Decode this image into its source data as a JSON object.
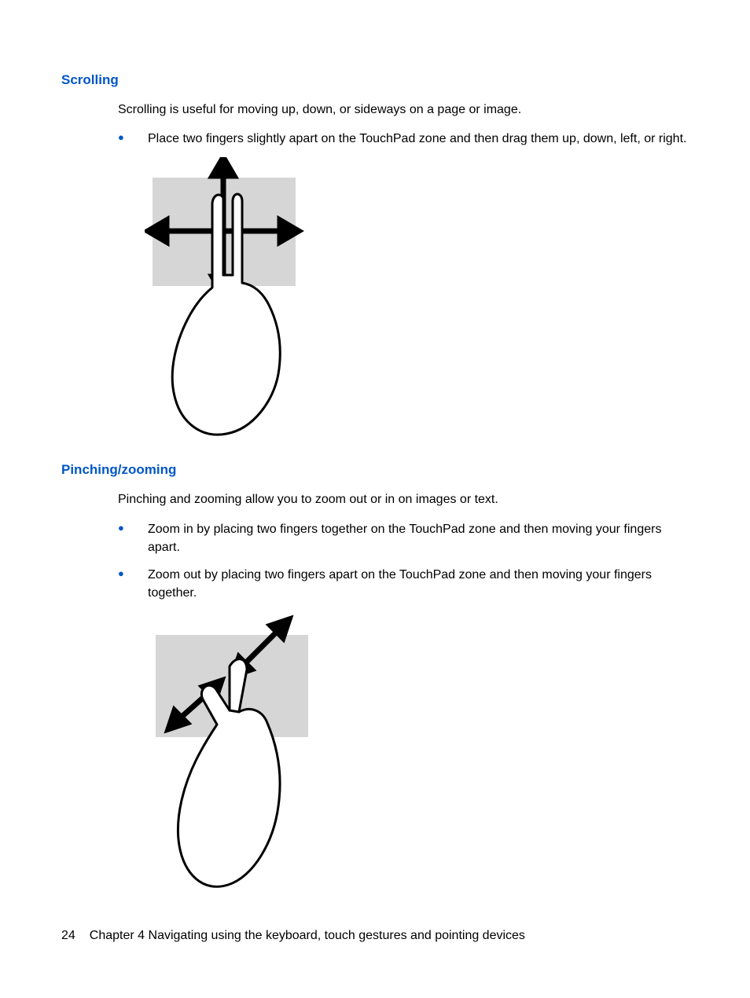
{
  "sections": [
    {
      "heading": "Scrolling",
      "intro": "Scrolling is useful for moving up, down, or sideways on a page or image.",
      "bullets": [
        "Place two fingers slightly apart on the TouchPad zone and then drag them up, down, left, or right."
      ]
    },
    {
      "heading": "Pinching/zooming",
      "intro": "Pinching and zooming allow you to zoom out or in on images or text.",
      "bullets": [
        "Zoom in by placing two fingers together on the TouchPad zone and then moving your fingers apart.",
        "Zoom out by placing two fingers apart on the TouchPad zone and then moving your fingers together."
      ]
    }
  ],
  "footer": {
    "page_number": "24",
    "chapter_text": "Chapter 4   Navigating using the keyboard, touch gestures and pointing devices"
  },
  "colors": {
    "heading": "#0056c7",
    "bullet": "#0056c7"
  }
}
